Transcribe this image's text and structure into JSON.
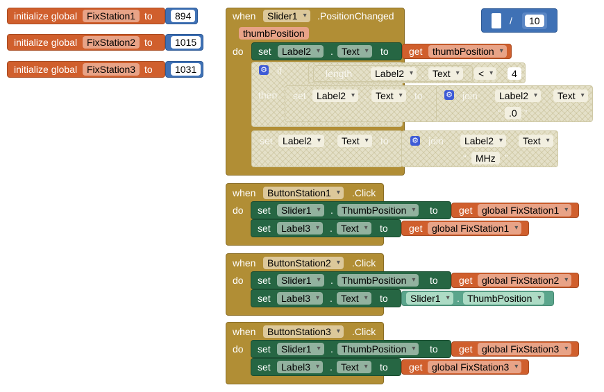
{
  "globals": [
    {
      "keyword": "initialize global",
      "name": "FixStation1",
      "to": "to",
      "value": "894"
    },
    {
      "keyword": "initialize global",
      "name": "FixStation2",
      "to": "to",
      "value": "1015"
    },
    {
      "keyword": "initialize global",
      "name": "FixStation3",
      "to": "to",
      "value": "1031"
    }
  ],
  "math_divide": {
    "op": "/",
    "value": "10"
  },
  "slider_event": {
    "when": "when",
    "component": "Slider1",
    "event": ".PositionChanged",
    "param": "thumbPosition",
    "do": "do",
    "set1": {
      "set": "set",
      "component": "Label2",
      "dot": ".",
      "prop": "Text",
      "to": "to",
      "get": "get",
      "var": "thumbPosition"
    },
    "if_block": {
      "if": "if",
      "length": "length",
      "component": "Label2",
      "dot": ".",
      "prop": "Text",
      "op": "<",
      "num": "4",
      "then": "then",
      "set": {
        "set": "set",
        "component": "Label2",
        "dot": ".",
        "prop": "Text",
        "to": "to",
        "join": "join",
        "join_component": "Label2",
        "join_prop": "Text",
        "text": ".0"
      }
    },
    "set2": {
      "set": "set",
      "component": "Label2",
      "dot": ".",
      "prop": "Text",
      "to": "to",
      "join": "join",
      "join_component": "Label2",
      "join_prop": "Text",
      "text": "MHz"
    }
  },
  "button_events": [
    {
      "when": "when",
      "component": "ButtonStation1",
      "event": ".Click",
      "do": "do",
      "row1": {
        "set": "set",
        "component": "Slider1",
        "dot": ".",
        "prop": "ThumbPosition",
        "to": "to",
        "get": "get",
        "var": "global FixStation1"
      },
      "row2": {
        "set": "set",
        "component": "Label3",
        "dot": ".",
        "prop": "Text",
        "to": "to",
        "get": "get",
        "var": "global FixStation1"
      }
    },
    {
      "when": "when",
      "component": "ButtonStation2",
      "event": ".Click",
      "do": "do",
      "row1": {
        "set": "set",
        "component": "Slider1",
        "dot": ".",
        "prop": "ThumbPosition",
        "to": "to",
        "get": "get",
        "var": "global FixStation2"
      },
      "row2": {
        "set": "set",
        "component": "Label3",
        "dot": ".",
        "prop": "Text",
        "to": "to",
        "src_component": "Slider1",
        "dot2": ".",
        "src_prop": "ThumbPosition"
      }
    },
    {
      "when": "when",
      "component": "ButtonStation3",
      "event": ".Click",
      "do": "do",
      "row1": {
        "set": "set",
        "component": "Slider1",
        "dot": ".",
        "prop": "ThumbPosition",
        "to": "to",
        "get": "get",
        "var": "global FixStation3"
      },
      "row2": {
        "set": "set",
        "component": "Label3",
        "dot": ".",
        "prop": "Text",
        "to": "to",
        "get": "get",
        "var": "global FixStation3"
      }
    }
  ],
  "colors": {
    "global": "#d05f2d",
    "event": "#b18e35",
    "setter": "#266643",
    "component_getter": "#5ba58c",
    "math": "#3f71b5",
    "control_gear": "#3e5bd6",
    "disabled": "#e4e0c8"
  },
  "icons": {
    "mutator": "gear-icon",
    "dropdown": "chevron-down-icon"
  }
}
